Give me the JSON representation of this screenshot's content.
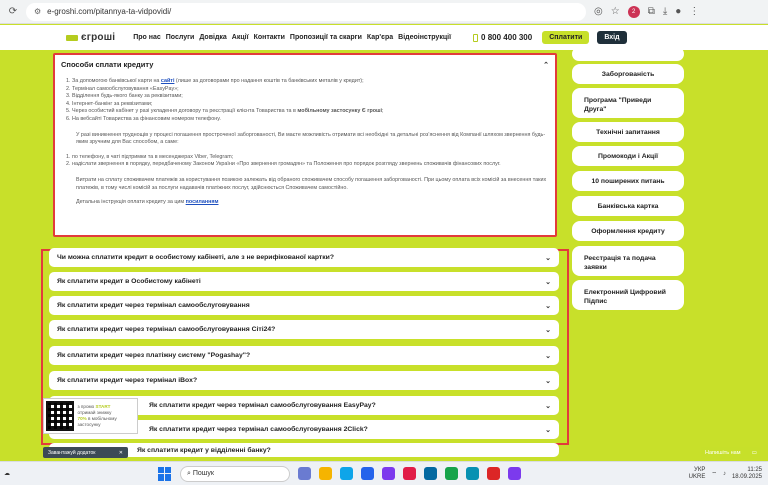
{
  "browser": {
    "url": "e-groshi.com/pitannya-ta-vidpovidi/",
    "profile_badge": "2"
  },
  "header": {
    "logo": "єгроші",
    "nav": [
      "Про нас",
      "Послуги",
      "Довідка",
      "Акції",
      "Контакти",
      "Пропозиції та скарги",
      "Кар'єра",
      "Відеоінструкції"
    ],
    "phone": "0 800 400 300",
    "pay_label": "Сплатити",
    "login_label": "Вхід"
  },
  "open_section": {
    "title": "Способи сплати кредиту",
    "list": [
      [
        "1. За допомогою банківської карти на ",
        "сайті",
        " (лише за договорами про надання коштів та банківських металів у кредит);"
      ],
      [
        "2. Термінал самообслуговування «EasyPay»;",
        "",
        ""
      ],
      [
        "3. Відділення будь-якого банку за реквізитами;",
        "",
        ""
      ],
      [
        "4. Інтернет-банкінг за реквізитами;",
        "",
        ""
      ],
      [
        "5. Через особистий кабінет у разі укладення договору та реєстрації клієнта Товариства та в ",
        "мобільному застосунку Є гроші",
        ";"
      ],
      [
        "6. На вебсайті Товариства за фінансовим номером телефону.",
        "",
        ""
      ]
    ],
    "para1": "У разі виникнення труднощів у процесі погашення простроченої заборгованості, Ви маєте можливість отримати всі необхідні та детальні роз’яснення від Компанії шляхом звернення будь-яким зручним для Вас способом, а саме:",
    "list2": [
      "1. по телефону, в чаті підтримки та в месенджерах Viber, Telegram;",
      "2. надіслати звернення в порядку, передбаченому Законом України «Про звернення громадян» та Положення про порядок розгляду звернень споживачів фінансових послуг."
    ],
    "para2": "Витрати на сплату споживачем платежів за користування позикою залежать від обраного споживачем способу погашення заборгованості. При цьому оплата всіх комісій за внесення таких платежів, в тому числі комісій за послуги надавачів платіжних послуг, здійснюється Споживачем самостійно.",
    "para3_prefix": "Детальна інструкція оплати кредиту за цим ",
    "para3_link": "посиланням"
  },
  "faq": [
    "Чи можна сплатити кредит в особистому кабінеті, але з не верифікованої картки?",
    "Як сплатити кредит в Особистому кабінеті",
    "Як сплатити кредит через термінал самообслуговування",
    "Як сплатити кредит через термінал самообслуговування Сіті24?",
    "Як сплатити кредит через платіжну систему \"Pogashay\"?",
    "Як сплатити кредит через термінал iBox?",
    "Як сплатити кредит через термінал самообслуговування EasyPay?",
    "Як сплатити кредит через термінал самообслуговування 2Click?",
    "Як сплатити кредит у відділенні банку?"
  ],
  "sidebar": [
    "Заборгованість",
    "Програма \"Приведи Друга\"",
    "Технічні запитання",
    "Промокоди і Акції",
    "10 поширених питань",
    "Банківська картка",
    "Оформлення кредиту",
    "Реєстрація та подача заявки",
    "Електронний Цифровий Підпис"
  ],
  "promo": {
    "line1": "з промо ",
    "code": "START",
    "line2": "отримай знижку",
    "discount": "70%",
    "line3": " в мобільному застосунку"
  },
  "extension_bar": "Завантажуй додаток",
  "chat_label": "Напишіть нам",
  "taskbar": {
    "search_placeholder": "Пошук",
    "lang": "УКР",
    "lang2": "UKRE",
    "time": "11:25",
    "date": "18.09.2025"
  }
}
